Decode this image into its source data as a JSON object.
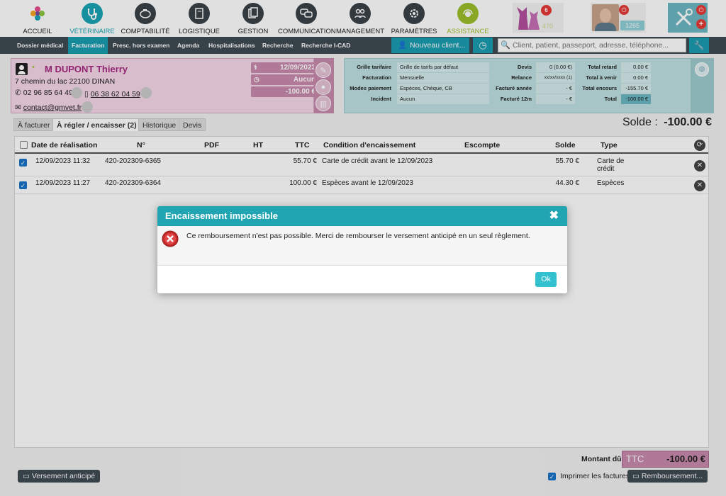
{
  "modules": [
    {
      "label": "ACCUEIL",
      "icon": "home-flower-icon",
      "color": "#ffffff"
    },
    {
      "label": "VÉTÉRINAIRE",
      "icon": "stethoscope-icon",
      "color": "#1aa3b5"
    },
    {
      "label": "COMPTABILITÉ",
      "icon": "piggy-bank-icon",
      "color": "#3b4248"
    },
    {
      "label": "LOGISTIQUE",
      "icon": "book-icon",
      "color": "#3b4248"
    },
    {
      "label": "GESTION",
      "icon": "documents-icon",
      "color": "#3b4248"
    },
    {
      "label": "COMMUNICATION",
      "icon": "chat-bubbles-icon",
      "color": "#3b4248"
    },
    {
      "label": "MANAGEMENT",
      "icon": "people-icon",
      "color": "#3b4248"
    },
    {
      "label": "PARAMÈTRES",
      "icon": "gear-icon",
      "color": "#3b4248"
    },
    {
      "label": "ASSISTANCE",
      "icon": "support-icon",
      "color": "#9bbf2a"
    }
  ],
  "notifications": {
    "badge": "6",
    "count": "470",
    "user_count": "1265"
  },
  "subnav": [
    "Dossier médical",
    "Facturation",
    "Presc. hors examen",
    "Agenda",
    "Hospitalisations",
    "Recherche",
    "Recherche I-CAD"
  ],
  "new_client_label": "Nouveau client...",
  "search": {
    "placeholder": "Client, patient, passeport, adresse, téléphone..."
  },
  "client": {
    "name": "M DUPONT Thierry",
    "address": "7 chemin du lac 22100 DINAN",
    "phone": "02 96 85 64 49",
    "mobile": "06 38 62 04 59",
    "email": "contact@gmvet.fr",
    "date": "12/09/2023",
    "status": "Aucun",
    "balance": "-100.00 €"
  },
  "account": {
    "grille_label": "Grille tarifaire",
    "grille_value": "Grille de tarifs par défaut",
    "facturation_label": "Facturation",
    "facturation_value": "Mensuelle",
    "modes_label": "Modes paiement",
    "modes_value": "Espèces, Chèque, CB",
    "incident_label": "Incident",
    "incident_value": "Aucun",
    "devis_label": "Devis",
    "devis_value": "0 (0.00 €)",
    "relance_label": "Relance",
    "relance_value": "xx/xx/xxxx (1)",
    "facture_annee_label": "Facturé année",
    "facture_annee_value": "- €",
    "facture_12m_label": "Facturé 12m",
    "facture_12m_value": "- €",
    "retard_label": "Total retard",
    "retard_value": "0.00 €",
    "avenir_label": "Total à venir",
    "avenir_value": "0.00 €",
    "encours_label": "Total encours",
    "encours_value": "-155.70 €",
    "total_label": "Total",
    "total_value": "-100.00 €"
  },
  "tabs": [
    "À facturer",
    "À régler / encaisser (2)",
    "Historique",
    "Devis"
  ],
  "solde": {
    "label": "Solde :",
    "value": "-100.00 €"
  },
  "table": {
    "headers": [
      "Date de réalisation",
      "N°",
      "PDF",
      "HT",
      "TTC",
      "Condition d'encaissement",
      "Escompte",
      "Solde",
      "Type"
    ],
    "rows": [
      {
        "date": "12/09/2023 11:32",
        "num": "420-202309-6365",
        "ttc": "55.70 €",
        "cond": "Carte de crédit avant le 12/09/2023",
        "solde": "55.70 €",
        "type": "Carte de crédit"
      },
      {
        "date": "12/09/2023 11:27",
        "num": "420-202309-6364",
        "ttc": "100.00 €",
        "cond": "Espèces avant le 12/09/2023",
        "solde": "44.30 €",
        "type": "Espèces"
      }
    ]
  },
  "modal": {
    "title": "Encaissement impossible",
    "message": "Ce remboursement n'est pas possible. Merci de rembourser le versement anticipé en un seul règlement.",
    "ok": "Ok"
  },
  "footer": {
    "montant_label": "Montant dû",
    "montant_ttc": "TTC",
    "montant_value": "-100.00 €",
    "versement_label": "Versement anticipé",
    "imprimer_label": "Imprimer les factures",
    "remboursement_label": "Remboursement..."
  }
}
